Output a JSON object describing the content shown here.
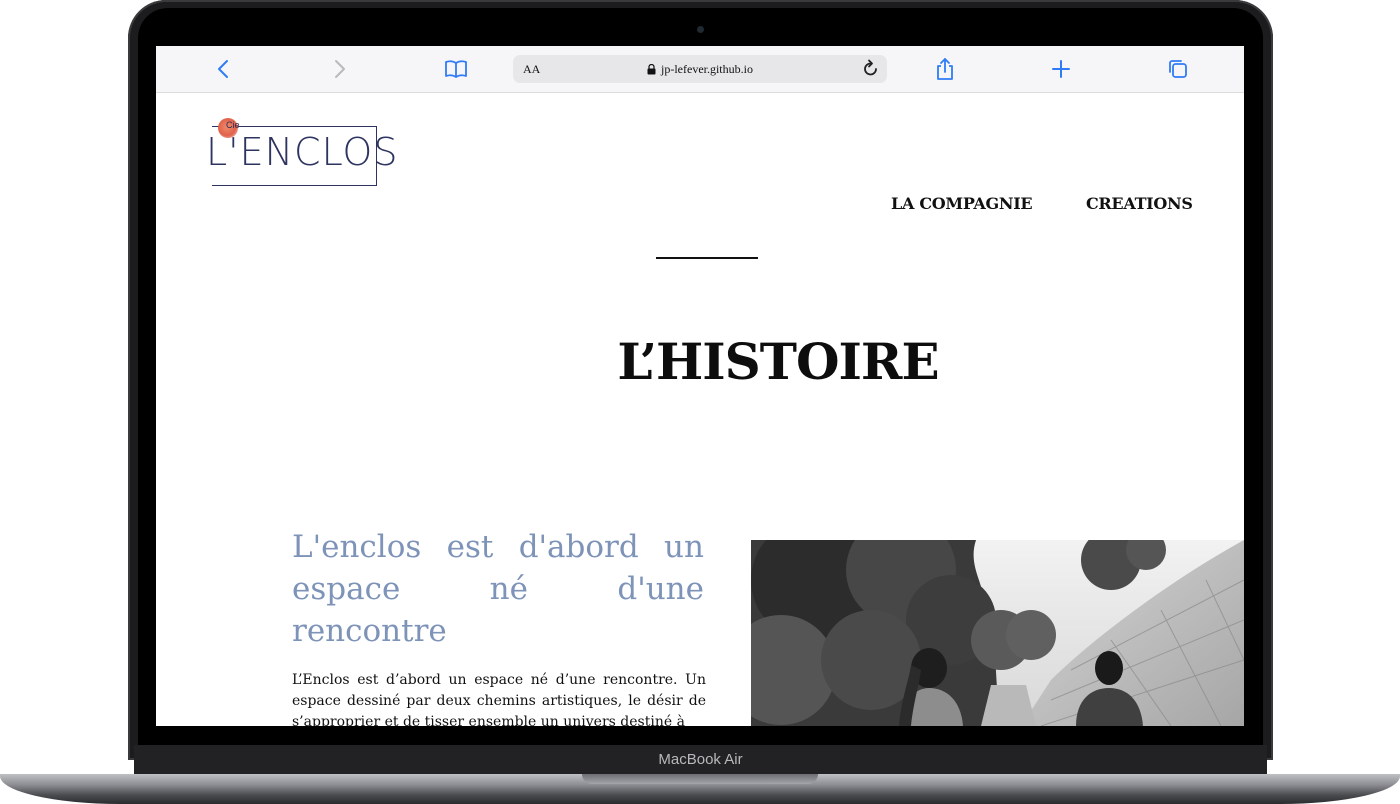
{
  "device": {
    "label": "MacBook Air"
  },
  "browser": {
    "reader_label": "AA",
    "url": "jp-lefever.github.io",
    "icons": [
      "back-icon",
      "forward-icon",
      "bookmarks-icon",
      "lock-icon",
      "reload-icon",
      "share-icon",
      "new-tab-icon",
      "tabs-icon"
    ]
  },
  "site": {
    "logo": {
      "prefix": "Cie",
      "name": "L'ENCLOS"
    },
    "nav": {
      "item1": "LA COMPAGNIE",
      "item2": "CREATIONS"
    },
    "page_title": "L’HISTOIRE",
    "section": {
      "heading": "L'enclos est d'abord un espace né d'une rencontre",
      "body": "L’Enclos est d’abord un espace né d’une rencontre. Un espace dessiné par deux chemins artistiques, le désir de s’approprier et de tisser ensemble un univers destiné à"
    }
  },
  "colors": {
    "accent_heading": "#7d93b8",
    "logo_ink": "#2e3460",
    "logo_dot": "#e0624b",
    "safari_blue": "#2f7cf6"
  }
}
